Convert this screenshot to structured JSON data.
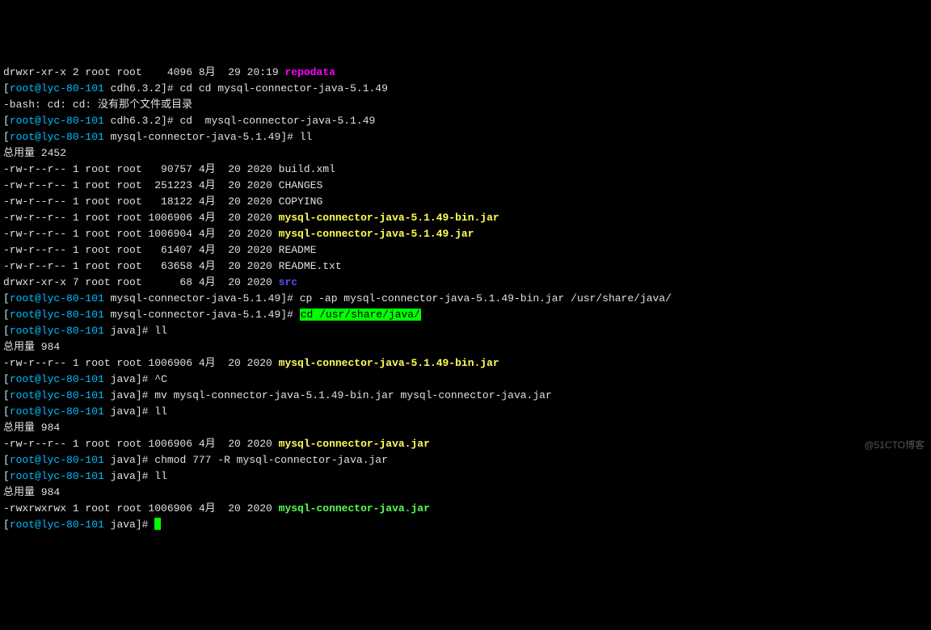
{
  "top_partial": {
    "perms": "drwxr-xr-x 2 root root    4096 8月  29 20:19 ",
    "name": "repodata"
  },
  "lines": [
    {
      "segs": [
        {
          "prompt": true,
          "user": "root",
          "host": "lyc-80-101",
          "path": "cdh6.3.2",
          "cmd": "cd cd mysql-connector-java-5.1.49"
        }
      ]
    },
    {
      "segs": [
        {
          "text": "-bash: cd: cd: 没有那个文件或目录",
          "cls": "white"
        }
      ]
    },
    {
      "segs": [
        {
          "prompt": true,
          "user": "root",
          "host": "lyc-80-101",
          "path": "cdh6.3.2",
          "cmd": "cd  mysql-connector-java-5.1.49"
        }
      ]
    },
    {
      "segs": [
        {
          "prompt": true,
          "user": "root",
          "host": "lyc-80-101",
          "path": "mysql-connector-java-5.1.49",
          "cmd": "ll"
        }
      ]
    },
    {
      "segs": [
        {
          "text": "总用量 2452",
          "cls": "white"
        }
      ]
    },
    {
      "segs": [
        {
          "text": "-rw-r--r-- 1 root root   90757 4月  20 2020 ",
          "cls": "white"
        },
        {
          "text": "build.xml",
          "cls": "white"
        }
      ]
    },
    {
      "segs": [
        {
          "text": "-rw-r--r-- 1 root root  251223 4月  20 2020 ",
          "cls": "white"
        },
        {
          "text": "CHANGES",
          "cls": "white"
        }
      ]
    },
    {
      "segs": [
        {
          "text": "-rw-r--r-- 1 root root   18122 4月  20 2020 ",
          "cls": "white"
        },
        {
          "text": "COPYING",
          "cls": "white"
        }
      ]
    },
    {
      "segs": [
        {
          "text": "-rw-r--r-- 1 root root 1006906 4月  20 2020 ",
          "cls": "white"
        },
        {
          "text": "mysql-connector-java-5.1.49-bin.jar",
          "cls": "yellow-bold"
        }
      ]
    },
    {
      "segs": [
        {
          "text": "-rw-r--r-- 1 root root 1006904 4月  20 2020 ",
          "cls": "white"
        },
        {
          "text": "mysql-connector-java-5.1.49.jar",
          "cls": "yellow-bold"
        }
      ]
    },
    {
      "segs": [
        {
          "text": "-rw-r--r-- 1 root root   61407 4月  20 2020 ",
          "cls": "white"
        },
        {
          "text": "README",
          "cls": "white"
        }
      ]
    },
    {
      "segs": [
        {
          "text": "-rw-r--r-- 1 root root   63658 4月  20 2020 ",
          "cls": "white"
        },
        {
          "text": "README.txt",
          "cls": "white"
        }
      ]
    },
    {
      "segs": [
        {
          "text": "drwxr-xr-x 7 root root      68 4月  20 2020 ",
          "cls": "white"
        },
        {
          "text": "src",
          "cls": "blue-bold"
        }
      ]
    },
    {
      "segs": [
        {
          "prompt": true,
          "user": "root",
          "host": "lyc-80-101",
          "path": "mysql-connector-java-5.1.49",
          "cmd": "cp -ap mysql-connector-java-5.1.49-bin.jar /usr/share/java/"
        }
      ]
    },
    {
      "segs": [
        {
          "prompt": true,
          "user": "root",
          "host": "lyc-80-101",
          "path": "mysql-connector-java-5.1.49",
          "cmd_segs": [
            {
              "text": "cd /usr/share/java/",
              "cls": "hl"
            }
          ]
        }
      ]
    },
    {
      "segs": [
        {
          "prompt": true,
          "user": "root",
          "host": "lyc-80-101",
          "path": "java",
          "cmd": "ll"
        }
      ]
    },
    {
      "segs": [
        {
          "text": "总用量 984",
          "cls": "white"
        }
      ]
    },
    {
      "segs": [
        {
          "text": "-rw-r--r-- 1 root root 1006906 4月  20 2020 ",
          "cls": "white"
        },
        {
          "text": "mysql-connector-java-5.1.49-bin.jar",
          "cls": "yellow-bold"
        }
      ]
    },
    {
      "segs": [
        {
          "prompt": true,
          "user": "root",
          "host": "lyc-80-101",
          "path": "java",
          "cmd": "^C"
        }
      ]
    },
    {
      "segs": [
        {
          "prompt": true,
          "user": "root",
          "host": "lyc-80-101",
          "path": "java",
          "cmd": "mv mysql-connector-java-5.1.49-bin.jar mysql-connector-java.jar"
        }
      ]
    },
    {
      "segs": [
        {
          "prompt": true,
          "user": "root",
          "host": "lyc-80-101",
          "path": "java",
          "cmd": "ll"
        }
      ]
    },
    {
      "segs": [
        {
          "text": "总用量 984",
          "cls": "white"
        }
      ]
    },
    {
      "segs": [
        {
          "text": "-rw-r--r-- 1 root root 1006906 4月  20 2020 ",
          "cls": "white"
        },
        {
          "text": "mysql-connector-java.jar",
          "cls": "yellow-bold"
        }
      ]
    },
    {
      "segs": [
        {
          "prompt": true,
          "user": "root",
          "host": "lyc-80-101",
          "path": "java",
          "cmd": "chmod 777 -R mysql-connector-java.jar"
        }
      ]
    },
    {
      "segs": [
        {
          "prompt": true,
          "user": "root",
          "host": "lyc-80-101",
          "path": "java",
          "cmd": "ll"
        }
      ]
    },
    {
      "segs": [
        {
          "text": "总用量 984",
          "cls": "white"
        }
      ]
    },
    {
      "segs": [
        {
          "text": "-rwxrwxrwx 1 root root 1006906 4月  20 2020 ",
          "cls": "white"
        },
        {
          "text": "mysql-connector-java.jar",
          "cls": "green-bold"
        }
      ]
    },
    {
      "segs": [
        {
          "prompt": true,
          "user": "root",
          "host": "lyc-80-101",
          "path": "java",
          "cmd": "",
          "cursor": true
        }
      ]
    }
  ],
  "watermark": "@51CTO博客"
}
